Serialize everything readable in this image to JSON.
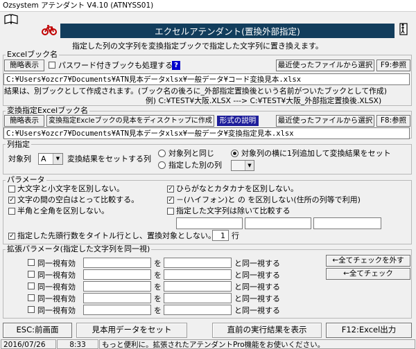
{
  "window": {
    "title": "Ozsystem アテンダント V4.10 (ATNYSS01)"
  },
  "header": {
    "banner": "エクセルアテンダント(置換外部指定)",
    "description": "指定した列の文字列を変換指定ブックで指定した文字列に置き換えます。"
  },
  "excel_book": {
    "group_label": "Excelブック名",
    "simple_label": "簡略表示",
    "password_label": "パスワード付きブックも処理する",
    "help_label": "?",
    "recent_label": "最近使ったファイルから選択",
    "browse_label": "F9:参照",
    "path": "C:¥Users¥ozcr7¥Documents¥ATN見本データxlsx¥一般データ¥コード変換見本.xlsx",
    "note1": "結果は、別ブックとして作成されます。(ブック名の後ろに_外部指定置換後という名前がついたブックとして作成)",
    "note2": "例) C:¥TEST¥大阪.XLSX ---> C:¥TEST¥大阪_外部指定置換後.XLSX)"
  },
  "convert_book": {
    "group_label": "変換指定Excelブック名",
    "simple_label": "簡略表示",
    "create_sample_label": "変換指定Excleブックの見本をディスクトップに作成",
    "format_label": "形式の説明",
    "recent_label": "最近使ったファイルから選択",
    "browse_label": "F8:参照",
    "path": "C:¥Users¥ozcr7¥Documents¥ATN見本データxlsx¥一般データ¥変換指定見本.xlsx"
  },
  "column_spec": {
    "group_label": "列指定",
    "target_label": "対象列",
    "target_value": "A",
    "result_label": "変換結果をセットする列",
    "opt_same": "対象列と同じ",
    "opt_add": "対象列の横に1列追加して変換結果をセット",
    "opt_other": "指定した別の列",
    "other_value": ""
  },
  "params": {
    "group_label": "パラメータ",
    "case": {
      "label": "大文字と小文字を区別しない。",
      "checked": false
    },
    "spaces": {
      "label": "文字の間の空白はとって比較する。",
      "checked": true
    },
    "width": {
      "label": "半角と全角を区別しない。",
      "checked": false
    },
    "kana": {
      "label": "ひらがなとカタカナを区別しない。",
      "checked": true
    },
    "hyphen": {
      "label": "－(ハイフォン)と の を区別しない(住所の列等で利用)",
      "checked": true
    },
    "exclude": {
      "label": "指定した文字列は除いて比較する",
      "checked": false
    },
    "exclude_values": [
      "",
      "",
      ""
    ],
    "header_rows_label": "指定した先頭行数をタイトル行とし、置換対象としない。",
    "header_rows_checked": true,
    "header_rows_value": "1",
    "header_rows_unit": "行"
  },
  "extended": {
    "group_label": "拡張パラメータ(指定した文字列を同一視)",
    "row_label": "同一視有効",
    "connector": "を",
    "suffix": "と同一視する",
    "rows": [
      {
        "checked": false,
        "from": "",
        "to": ""
      },
      {
        "checked": false,
        "from": "",
        "to": ""
      },
      {
        "checked": false,
        "from": "",
        "to": ""
      },
      {
        "checked": false,
        "from": "",
        "to": ""
      },
      {
        "checked": false,
        "from": "",
        "to": ""
      }
    ],
    "uncheck_all": "←全てチェックを外す",
    "check_all": "←全てチェック"
  },
  "footer": {
    "esc_label": "ESC:前画面",
    "sample_label": "見本用データをセット",
    "last_result_label": "直前の実行結果を表示",
    "f12_label": "F12:Excel出力"
  },
  "statusbar": {
    "date": "2016/07/26",
    "time": "8:33",
    "message": "もっと便利に。拡張されたアテンダントPro機能をお使いください。"
  }
}
